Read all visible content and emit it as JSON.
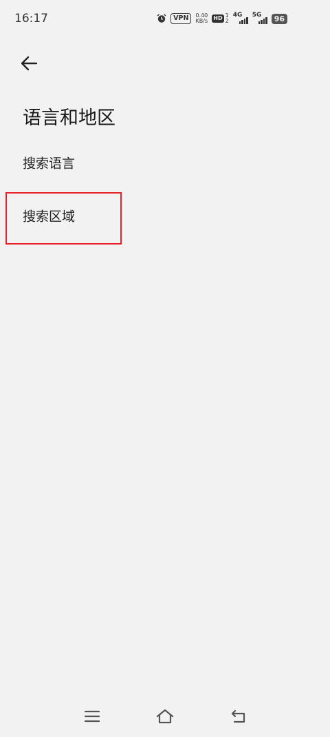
{
  "status_bar": {
    "time": "16:17",
    "vpn": "VPN",
    "net_speed_value": "0.40",
    "net_speed_unit": "KB/s",
    "hd": "HD",
    "sim1": "1",
    "sim2": "2",
    "sim1_type": "4G",
    "sim2_type": "5G",
    "battery": "96"
  },
  "header": {
    "back_icon": "arrow-left-icon",
    "title": "语言和地区"
  },
  "menu": {
    "items": [
      {
        "label": "搜索语言"
      },
      {
        "label": "搜索区域"
      }
    ]
  },
  "highlight_color": "#e8202a",
  "nav_bar": {
    "menu_icon": "menu-icon",
    "home_icon": "home-icon",
    "back_icon": "back-return-icon"
  }
}
